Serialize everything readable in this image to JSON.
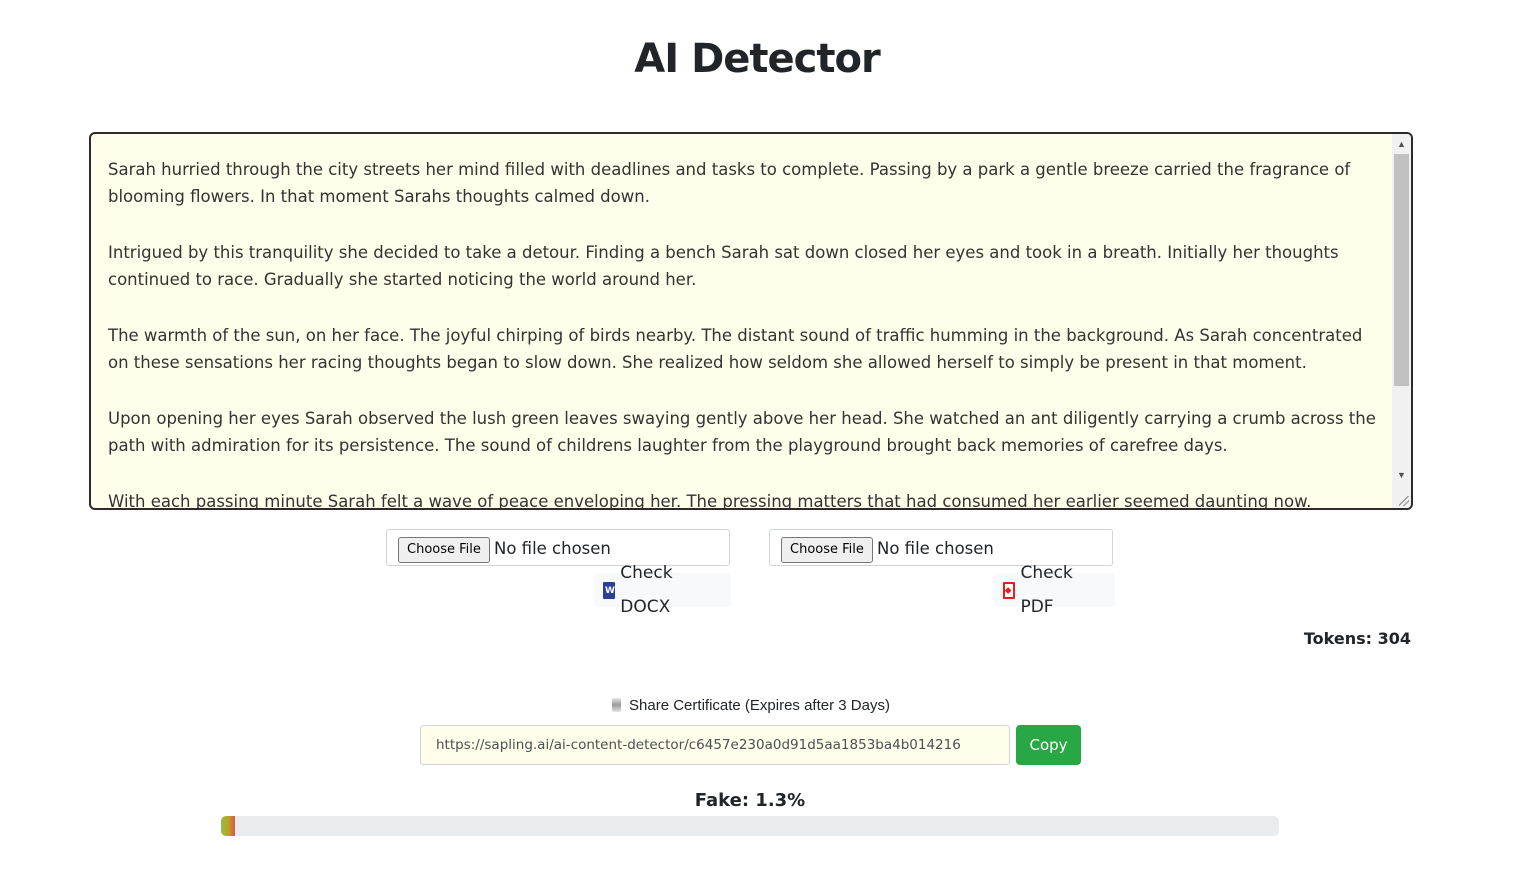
{
  "page": {
    "title": "AI Detector"
  },
  "editor": {
    "paragraphs": [
      "Sarah hurried through the city streets her mind filled with deadlines and tasks to complete. Passing by a park a gentle breeze carried the fragrance of blooming flowers. In that moment Sarahs thoughts calmed down.",
      "Intrigued by this tranquility she decided to take a detour. Finding a bench Sarah sat down closed her eyes and took in a breath. Initially her thoughts continued to race. Gradually she started noticing the world around her.",
      "The warmth of the sun, on her face. The joyful chirping of birds nearby. The distant sound of traffic humming in the background. As Sarah concentrated on these sensations her racing thoughts began to slow down. She realized how seldom she allowed herself to simply be present in that moment.",
      "Upon opening her eyes Sarah observed the lush green leaves swaying gently above her head. She watched an ant diligently carrying a crumb across the path with admiration for its persistence. The sound of childrens laughter from the playground brought back memories of carefree days.",
      "With each passing minute Sarah felt a wave of peace enveloping her. The pressing matters that had consumed her earlier seemed daunting now. Through"
    ]
  },
  "uploads": {
    "docx": {
      "choose_label": "Choose File",
      "status": "No file chosen",
      "check_label": "Check DOCX",
      "icon": "word-icon"
    },
    "pdf": {
      "choose_label": "Choose File",
      "status": "No file chosen",
      "check_label": "Check PDF",
      "icon": "pdf-icon"
    }
  },
  "tokens": {
    "label": "Tokens: 304"
  },
  "share": {
    "icon": "scroll-icon",
    "label": "Share Certificate (Expires after 3 Days)",
    "url": "https://sapling.ai/ai-content-detector/c6457e230a0d91d5aa1853ba4b014216",
    "copy_label": "Copy"
  },
  "result": {
    "fake_label": "Fake: 1.3%",
    "fake_percent": 1.3
  },
  "colors": {
    "editor_bg": "#fefeea",
    "copy_button": "#28a745",
    "progress_track": "#e9ecef"
  }
}
